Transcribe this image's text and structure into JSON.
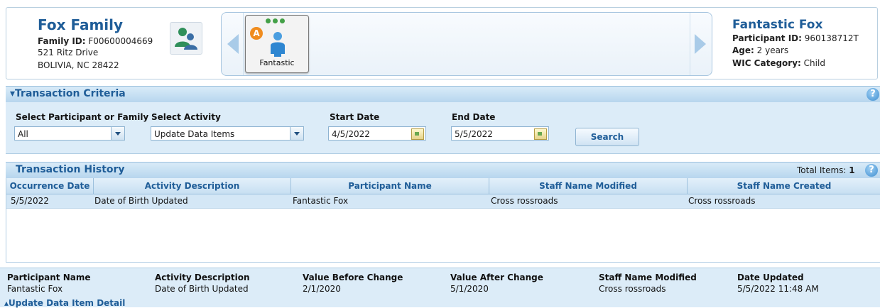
{
  "family": {
    "title": "Fox Family",
    "id_label": "Family ID:",
    "id_value": "F00600004669",
    "address1": "521 Ritz Drive",
    "address2": "BOLIVIA,  NC  28422"
  },
  "carousel": {
    "participant_card": {
      "badge": "A",
      "name": "Fantastic"
    }
  },
  "participant": {
    "name": "Fantastic Fox",
    "id_label": "Participant ID:",
    "id_value": "960138712T",
    "age_label": "Age:",
    "age_value": "2 years",
    "category_label": "WIC Category:",
    "category_value": "Child"
  },
  "criteria": {
    "title": "Transaction Criteria",
    "participant_label": "Select Participant or Family",
    "participant_value": "All",
    "activity_label": "Select Activity",
    "activity_value": "Update Data Items",
    "start_label": "Start Date",
    "start_value": "4/5/2022",
    "end_label": "End Date",
    "end_value": "5/5/2022",
    "search_label": "Search"
  },
  "history": {
    "title": "Transaction History",
    "total_label": "Total Items:",
    "total_value": "1",
    "columns": [
      "Occurrence Date",
      "Activity Description",
      "Participant Name",
      "Staff Name Modified",
      "Staff Name Created"
    ],
    "rows": [
      [
        "5/5/2022",
        "Date of Birth Updated",
        "Fantastic Fox",
        "Cross rossroads",
        "Cross rossroads"
      ]
    ]
  },
  "detail": {
    "labels": [
      "Participant Name",
      "Activity Description",
      "Value Before Change",
      "Value After Change",
      "Staff Name Modified",
      "Date Updated"
    ],
    "values": [
      "Fantastic Fox",
      "Date of Birth Updated",
      "2/1/2020",
      "5/1/2020",
      "Cross rossroads",
      "5/5/2022 11:48 AM"
    ],
    "footer": "Update Data Item Detail"
  },
  "icons": {
    "help": "?",
    "accent": "#1f5d98",
    "status_dots": "#43a047",
    "badge": "#f08c1e"
  }
}
